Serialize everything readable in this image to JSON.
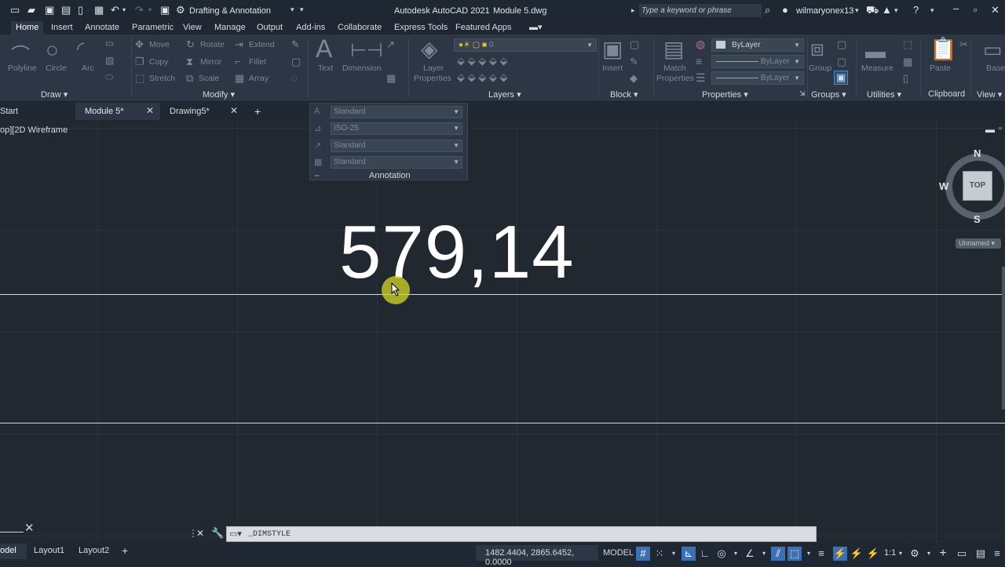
{
  "app": {
    "title": "Autodesk AutoCAD 2021",
    "file": "Module 5.dwg",
    "workspace": "Drafting & Annotation",
    "search_placeholder": "Type a keyword or phrase",
    "user": "wilmaryonex13"
  },
  "menu": [
    "Home",
    "Insert",
    "Annotate",
    "Parametric",
    "View",
    "Manage",
    "Output",
    "Add-ins",
    "Collaborate",
    "Express Tools",
    "Featured Apps"
  ],
  "ribbon": {
    "draw": {
      "polyline": "Polyline",
      "circle": "Circle",
      "arc": "Arc",
      "label": "Draw"
    },
    "modify": {
      "move": "Move",
      "rotate": "Rotate",
      "extend": "Extend",
      "copy": "Copy",
      "mirror": "Mirror",
      "fillet": "Fillet",
      "stretch": "Stretch",
      "scale": "Scale",
      "array": "Array",
      "label": "Modify"
    },
    "annotation": {
      "text": "Text",
      "dimension": "Dimension"
    },
    "layers": {
      "layer_properties_1": "Layer",
      "layer_properties_2": "Properties",
      "current": "0",
      "label": "Layers"
    },
    "block": {
      "insert": "Insert",
      "label": "Block"
    },
    "properties": {
      "match_1": "Match",
      "match_2": "Properties",
      "color": "ByLayer",
      "linetype": "ByLayer",
      "lineweight": "ByLayer",
      "label": "Properties"
    },
    "groups": {
      "group": "Group",
      "label": "Groups"
    },
    "utilities": {
      "measure": "Measure",
      "label": "Utilities"
    },
    "clipboard": {
      "paste": "Paste",
      "label": "Clipboard"
    },
    "view": {
      "base": "Base",
      "label": "View"
    }
  },
  "tabs": {
    "start": "Start",
    "module5": "Module 5*",
    "drawing5": "Drawing5*"
  },
  "annotation_panel": {
    "text_style": "Standard",
    "dim_style": "ISO-25",
    "leader_style": "Standard",
    "table_style": "Standard",
    "label": "Annotation"
  },
  "viewport": {
    "label": "op][2D Wireframe"
  },
  "drawing": {
    "dimension_text": "579,14"
  },
  "viewcube": {
    "n": "N",
    "w": "W",
    "s": "S",
    "top": "TOP",
    "ucs": "Unnamed"
  },
  "command": {
    "text": "_DIMSTYLE"
  },
  "layout_tabs": {
    "model": "odel",
    "layout1": "Layout1",
    "layout2": "Layout2"
  },
  "status": {
    "coords": "1482.4404, 2865.6452, 0.0000",
    "model": "MODEL",
    "scale": "1:1"
  }
}
